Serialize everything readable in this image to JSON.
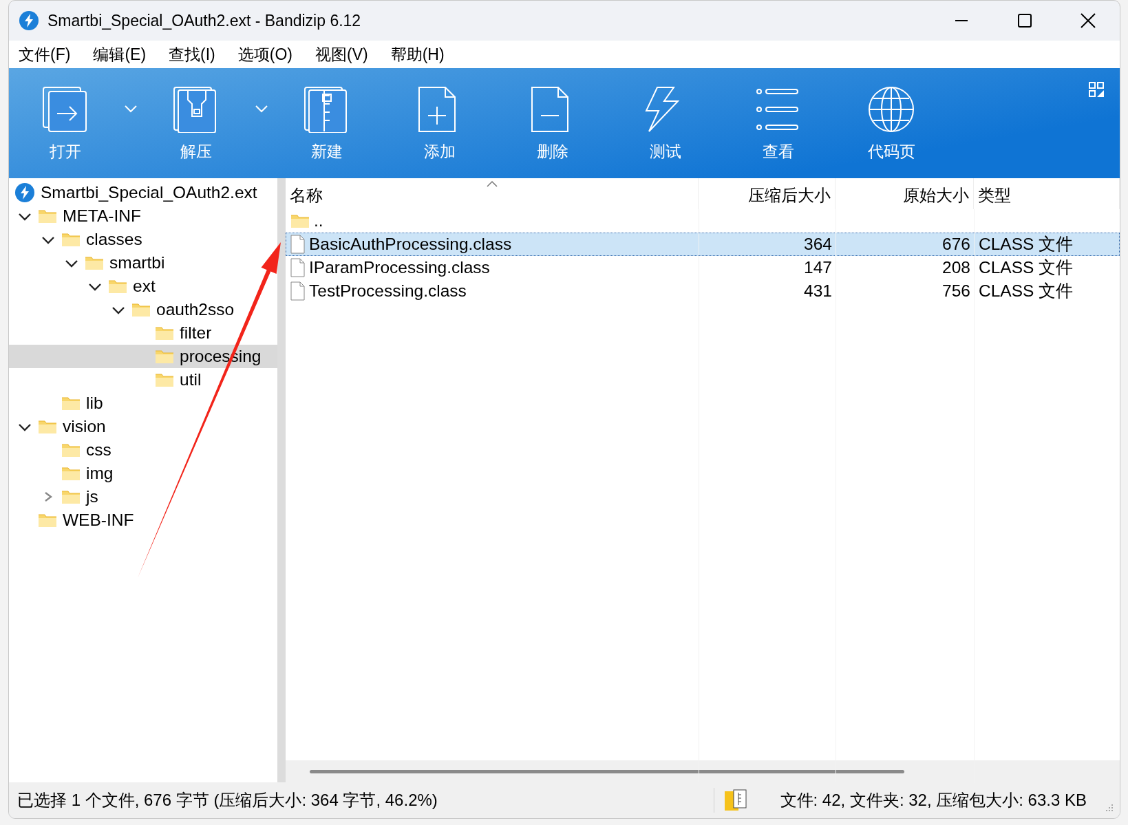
{
  "window": {
    "title": "Smartbi_Special_OAuth2.ext - Bandizip 6.12"
  },
  "menu": [
    "文件(F)",
    "编辑(E)",
    "查找(I)",
    "选项(O)",
    "视图(V)",
    "帮助(H)"
  ],
  "toolbar": [
    {
      "label": "打开",
      "kind": "open",
      "dropdown": true
    },
    {
      "label": "解压",
      "kind": "extract",
      "dropdown": true
    },
    {
      "label": "新建",
      "kind": "new",
      "dropdown": false
    },
    {
      "label": "添加",
      "kind": "add",
      "dropdown": false
    },
    {
      "label": "删除",
      "kind": "delete",
      "dropdown": false
    },
    {
      "label": "测试",
      "kind": "test",
      "dropdown": false
    },
    {
      "label": "查看",
      "kind": "view",
      "dropdown": false
    },
    {
      "label": "代码页",
      "kind": "codepage",
      "dropdown": false
    }
  ],
  "tree": {
    "root": "Smartbi_Special_OAuth2.ext",
    "items": [
      {
        "label": "META-INF",
        "selected": false,
        "expanded": true,
        "children": [
          {
            "label": "classes",
            "selected": false,
            "expanded": true,
            "children": [
              {
                "label": "smartbi",
                "selected": false,
                "expanded": true,
                "children": [
                  {
                    "label": "ext",
                    "selected": false,
                    "expanded": true,
                    "children": [
                      {
                        "label": "oauth2sso",
                        "selected": false,
                        "expanded": true,
                        "children": [
                          {
                            "label": "filter",
                            "selected": false
                          },
                          {
                            "label": "processing",
                            "selected": true
                          },
                          {
                            "label": "util",
                            "selected": false
                          }
                        ]
                      }
                    ]
                  }
                ]
              }
            ]
          },
          {
            "label": "lib",
            "selected": false
          }
        ]
      },
      {
        "label": "vision",
        "selected": false,
        "expanded": true,
        "children": [
          {
            "label": "css",
            "selected": false
          },
          {
            "label": "img",
            "selected": false
          },
          {
            "label": "js",
            "selected": false,
            "expanded": false
          }
        ]
      },
      {
        "label": "WEB-INF",
        "selected": false
      }
    ]
  },
  "table": {
    "columns": [
      {
        "label": "名称",
        "sorted": true
      },
      {
        "label": "压缩后大小",
        "sorted": false
      },
      {
        "label": "原始大小",
        "sorted": false
      },
      {
        "label": "类型",
        "sorted": false
      }
    ],
    "rows": [
      {
        "kind": "folder",
        "selected": false,
        "cells": [
          "..",
          "",
          "",
          ""
        ]
      },
      {
        "kind": "file",
        "selected": true,
        "cells": [
          "BasicAuthProcessing.class",
          "364",
          "676",
          "CLASS 文件"
        ]
      },
      {
        "kind": "file",
        "selected": false,
        "cells": [
          "IParamProcessing.class",
          "147",
          "208",
          "CLASS 文件"
        ]
      },
      {
        "kind": "file",
        "selected": false,
        "cells": [
          "TestProcessing.class",
          "431",
          "756",
          "CLASS 文件"
        ]
      }
    ]
  },
  "status_bar": {
    "left": "已选择 1 个文件, 676 字节 (压缩后大小: 364 字节, 46.2%)",
    "right": "文件: 42, 文件夹: 32, 压缩包大小: 63.3 KB"
  },
  "annotations": [
    {
      "kind": "arrow"
    }
  ]
}
